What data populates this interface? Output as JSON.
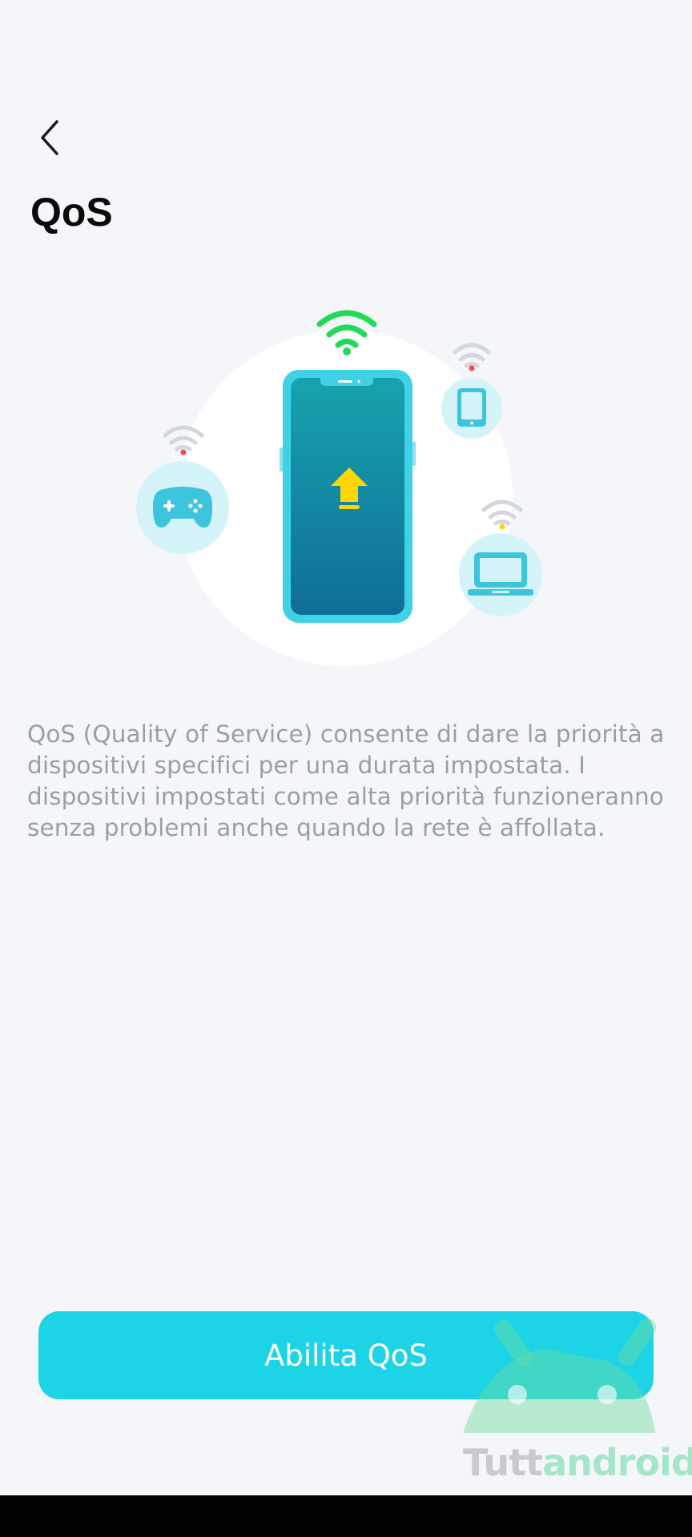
{
  "header": {
    "back_icon": "chevron-left-icon",
    "title": "QoS"
  },
  "illustration": {
    "icons": [
      "wifi-icon",
      "phone-icon",
      "upload-arrow-icon",
      "gamepad-icon",
      "tablet-icon",
      "laptop-icon"
    ],
    "colors": {
      "phone_screen_top": "#17a3ae",
      "phone_screen_bottom": "#0f6e96",
      "phone_frame": "#3fd1e6",
      "wifi_main": "#22d95a",
      "arrow": "#ffd600",
      "device_circle": "#d4f4fa",
      "device_icon": "#3ec5de"
    }
  },
  "main": {
    "description": "QoS (Quality of Service) consente di dare la priorità a dispositivi specifici per una durata impostata. I dispositivi impostati come alta priorità funzioneranno senza problemi anche quando la rete è affollata."
  },
  "actions": {
    "enable_label": "Abilita QoS"
  },
  "watermark": {
    "part1": "Tutt",
    "part2": "android"
  },
  "colors": {
    "background": "#f4f6fa",
    "accent": "#1dd3e6",
    "text_secondary": "#9a9ea6"
  }
}
